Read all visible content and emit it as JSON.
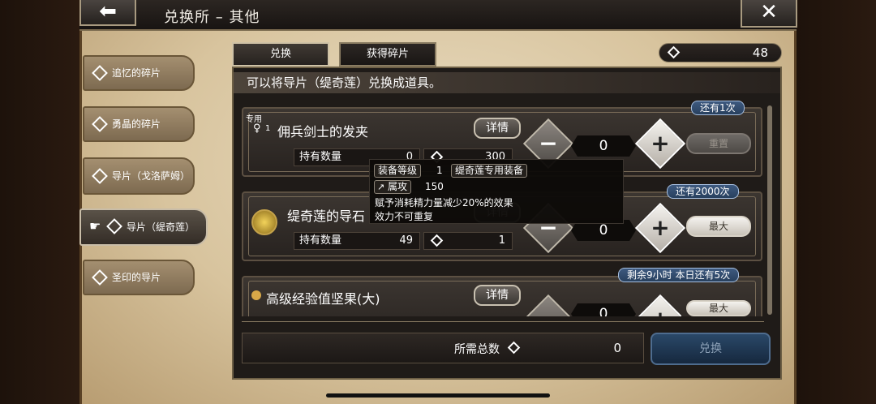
{
  "header": {
    "title": "兑换所 – 其他",
    "back_glyph": "⬅",
    "close_glyph": "✕"
  },
  "sidebar": {
    "items": [
      {
        "label": "追忆的碎片",
        "icon": "diamond-icon"
      },
      {
        "label": "勇晶的碎片",
        "icon": "diamond-icon"
      },
      {
        "label": "导片（戈洛萨姆）",
        "icon": "diamond-icon"
      },
      {
        "label": "导片（缇奇莲）",
        "icon": "diamond-icon",
        "active": true,
        "pointer": "☛"
      },
      {
        "label": "圣印的导片",
        "icon": "diamond-icon"
      }
    ]
  },
  "tabs": [
    {
      "label": "兑换",
      "active": true
    },
    {
      "label": "获得碎片",
      "active": false
    }
  ],
  "currency": {
    "value": "48",
    "icon": "diamond-icon"
  },
  "panel_header": "可以将导片（缇奇莲）兑换成道具。",
  "items": [
    {
      "badge": "还有1次",
      "tag": "专用",
      "icon_glyph": "♀",
      "level": "1",
      "name": "佣兵剑士的发夹",
      "detail": "详情",
      "holding_label": "持有数量",
      "holding_value": "0",
      "cost": "300",
      "qty": "0",
      "action": "重置",
      "action_disabled": true
    },
    {
      "badge": "还有2000次",
      "name": "缇奇莲的导石",
      "detail": "详情",
      "holding_label": "持有数量",
      "holding_value": "49",
      "cost": "1",
      "qty": "0",
      "action": "最大",
      "action_disabled": false
    },
    {
      "badge": "剩余9小时  本日还有5次",
      "name": "高级经验值坚果(大)",
      "detail": "详情",
      "qty": "0",
      "action": "最大",
      "action_disabled": false
    }
  ],
  "tooltip": {
    "equip_level_label": "装备等级",
    "equip_level_value": "1",
    "equip_type": "缇奇莲专用装备",
    "attr_label": "属攻",
    "attr_value": "150",
    "desc_line1": "赋予消耗精力量减少20%的效果",
    "desc_line2": "效力不可重复"
  },
  "footer": {
    "total_label": "所需总数",
    "total_value": "0",
    "exchange_label": "兑换"
  },
  "colors": {
    "badge_blue": "#3e5a80",
    "exchange_blue": "#2a4868",
    "parchment": "#e9dcc1"
  }
}
